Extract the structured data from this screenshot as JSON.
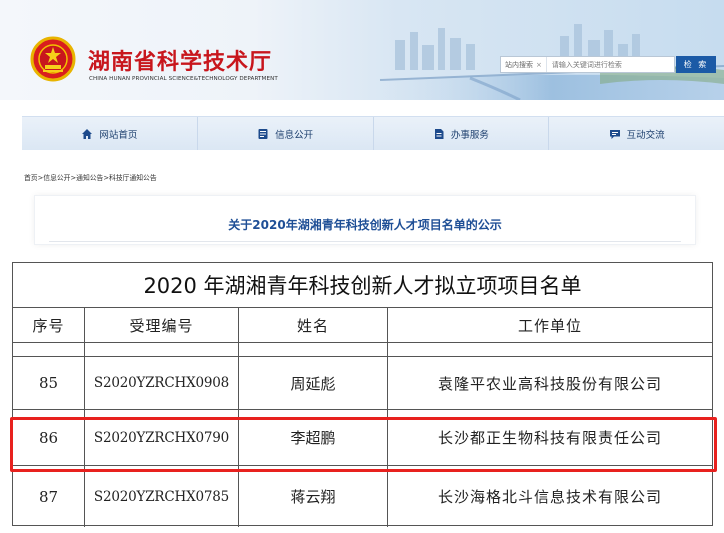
{
  "site": {
    "title": "湖南省科学技术厅",
    "subtitle": "CHINA HUNAN PROVINCIAL SCIENCE&TECHNOLOGY DEPARTMENT",
    "emblem_icon": "national-emblem-icon",
    "brand_color": "#c8161d"
  },
  "search": {
    "scope_label": "站内搜索",
    "clear_icon": "×",
    "placeholder": "请输入关键词进行检索",
    "button_label": "检 索"
  },
  "nav": {
    "items": [
      {
        "label": "网站首页",
        "icon": "home-icon"
      },
      {
        "label": "信息公开",
        "icon": "document-list-icon"
      },
      {
        "label": "办事服务",
        "icon": "file-service-icon"
      },
      {
        "label": "互动交流",
        "icon": "chat-icon"
      }
    ]
  },
  "breadcrumb": "首页>信息公开>通知公告>科技厅通知公告",
  "article": {
    "title": "关于2020年湖湘青年科技创新人才项目名单的公示"
  },
  "document": {
    "title": "2020 年湖湘青年科技创新人才拟立项项目名单",
    "columns": [
      "序号",
      "受理编号",
      "姓名",
      "工作单位"
    ],
    "rows": [
      {
        "no": "85",
        "code": "S2020YZRCHX0908",
        "name": "周延彪",
        "unit": "袁隆平农业高科技股份有限公司"
      },
      {
        "no": "86",
        "code": "S2020YZRCHX0790",
        "name": "李超鹏",
        "unit": "长沙都正生物科技有限责任公司"
      },
      {
        "no": "87",
        "code": "S2020YZRCHX0785",
        "name": "蒋云翔",
        "unit": "长沙海格北斗信息技术有限公司"
      }
    ],
    "highlight_color": "#e8211e"
  }
}
